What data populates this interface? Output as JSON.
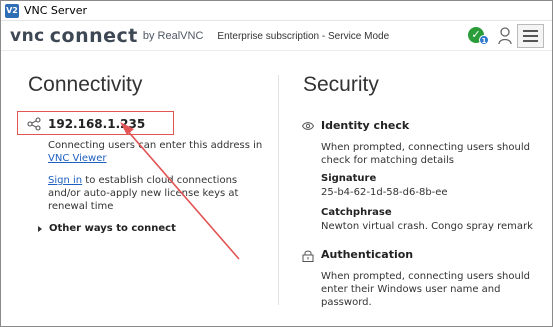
{
  "window": {
    "title": "VNC Server",
    "app_icon": "V2"
  },
  "header": {
    "brand_vnc": "vnc",
    "brand_connect": "connect",
    "brand_by": "by RealVNC",
    "subscription": "Enterprise subscription - Service Mode",
    "status_badge_count": "1",
    "icons": [
      "status-check-icon",
      "user-icon",
      "menu-icon"
    ]
  },
  "connectivity": {
    "title": "Connectivity",
    "ip_address": "192.168.1.235",
    "hint_text": "Connecting users can enter this address in ",
    "hint_link": "VNC Viewer",
    "signin_link": "Sign in",
    "signin_text": " to establish cloud connections and/or auto-apply new license keys at renewal time",
    "other_ways": "Other ways to connect"
  },
  "security": {
    "title": "Security",
    "identity_heading": "Identity check",
    "identity_desc": "When prompted, connecting users should check for matching details",
    "signature_label": "Signature",
    "signature_value": "25-b4-62-1d-58-d6-8b-ee",
    "catchphrase_label": "Catchphrase",
    "catchphrase_value": "Newton virtual crash. Congo spray remark",
    "auth_heading": "Authentication",
    "auth_desc": "When prompted, connecting users should enter their Windows user name and password."
  },
  "colors": {
    "annotation_red": "#e25555",
    "link_blue": "#1f5fbf",
    "status_green": "#2a9d3a",
    "badge_blue": "#2e78d0"
  }
}
